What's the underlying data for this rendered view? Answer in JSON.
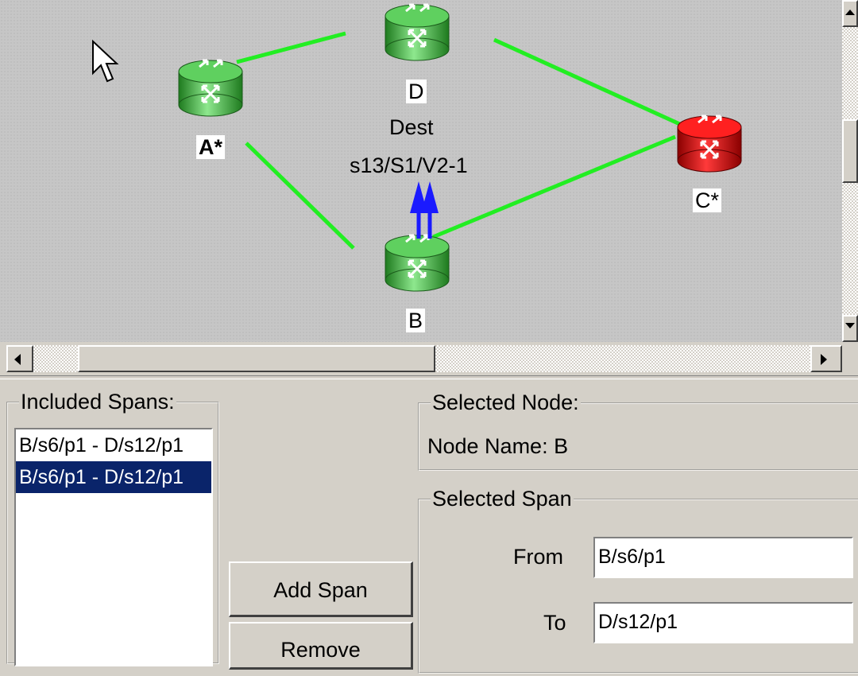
{
  "topology": {
    "nodes": [
      {
        "id": "A",
        "label": "A*",
        "bold": true,
        "color": "green"
      },
      {
        "id": "D",
        "label": "D",
        "bold": false,
        "color": "green"
      },
      {
        "id": "C",
        "label": "C*",
        "bold": false,
        "color": "red"
      },
      {
        "id": "B",
        "label": "B",
        "bold": false,
        "color": "green"
      }
    ],
    "dest_label": "Dest",
    "dest_port": "s13/S1/V2-1",
    "colors": {
      "link": "#22ee22",
      "arrow": "#1a1aff",
      "node_green": "#3fbf3f",
      "node_red": "#e00000"
    }
  },
  "included_spans": {
    "title": "Included Spans:",
    "items": [
      "B/s6/p1 - D/s12/p1",
      "B/s6/p1 - D/s12/p1"
    ],
    "selected_index": 1
  },
  "buttons": {
    "add_span": "Add Span",
    "remove": "Remove"
  },
  "selected_node": {
    "title": "Selected Node:",
    "name_label": "Node Name: B"
  },
  "selected_span": {
    "title": "Selected Span",
    "from_label": "From",
    "from_value": "B/s6/p1",
    "to_label": "To",
    "to_value": "D/s12/p1"
  }
}
